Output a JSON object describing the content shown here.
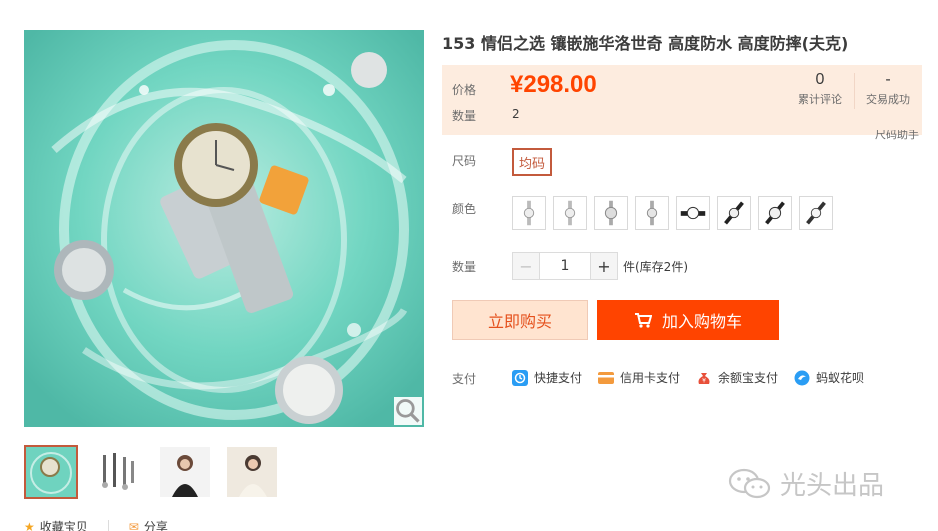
{
  "product": {
    "title": "153 情侣之选 镶嵌施华洛世奇 高度防水 高度防摔(夫克)"
  },
  "price_panel": {
    "price_label": "价格",
    "price": "¥298.00",
    "qty_label": "数量",
    "qty_value": "2",
    "reviews_count": "0",
    "reviews_label": "累计评论",
    "success_count": "-",
    "success_label": "交易成功",
    "size_helper": "尺码助手"
  },
  "options": {
    "size_label": "尺码",
    "size_value": "均码",
    "color_label": "颜色",
    "quantity_label": "数量",
    "quantity_value": "1",
    "minus": "−",
    "plus": "+",
    "stock_text": "件(库存2件)"
  },
  "actions": {
    "buy_now": "立即购买",
    "add_to_cart": "加入购物车"
  },
  "payment": {
    "label": "支付",
    "methods": [
      {
        "label": "快捷支付",
        "icon": "quickpay-icon",
        "color": "#2a9df4"
      },
      {
        "label": "信用卡支付",
        "icon": "credit-card-icon",
        "color": "#f39a3d"
      },
      {
        "label": "余额宝支付",
        "icon": "yuebao-icon",
        "color": "#e8503a"
      },
      {
        "label": "蚂蚁花呗",
        "icon": "huabei-icon",
        "color": "#2a9df4"
      }
    ]
  },
  "footer_links": {
    "favorite": "收藏宝贝",
    "share": "分享"
  },
  "watermark": {
    "text": "光头出品"
  },
  "colors": {
    "accent": "#ff4400",
    "price": "#ff4400",
    "selected_border": "#c35a3c",
    "price_bg": "#fdecdf"
  }
}
